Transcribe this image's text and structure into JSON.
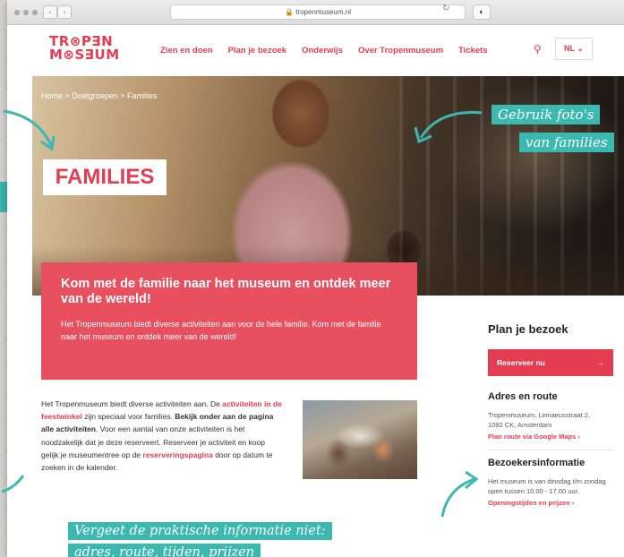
{
  "browser": {
    "url": "tropenmuseum.nl",
    "back_icon": "‹",
    "forward_icon": "›",
    "reload_icon": "↻",
    "shield_icon": "◐"
  },
  "logo": {
    "line1": "TR⊗P∃N",
    "line2": "M⊗S∃UM"
  },
  "nav": {
    "items": [
      "Zien en doen",
      "Plan je bezoek",
      "Onderwijs",
      "Over Tropenmuseum",
      "Tickets"
    ],
    "search_icon": "⚲",
    "lang": "NL ⌄"
  },
  "hero": {
    "breadcrumb": "Home > Doelgroepen > Families",
    "title": "FAMILIES"
  },
  "intro": {
    "heading": "Kom met de familie naar het museum en ontdek meer van de wereld!",
    "text": "Het Tropenmuseum biedt diverse activiteiten aan voor de hele familie. Kom met de familie naar het museum en ontdek meer van de wereld!"
  },
  "body": {
    "p1": "Het Tropenmuseum biedt diverse activiteiten aan. De ",
    "link1": "activiteiten in de feestwinkel",
    "p2": " zijn speciaal voor families. ",
    "bold1": "Bekijk onder aan de pagina alle activiteiten",
    "p3": ". Voor een aantal van onze activiteiten is het noodzakelijk dat je deze reserveert. Reserveer je activiteit en koop gelijk je museumentree op de ",
    "link2": "reserveringspagina",
    "p4": " door op datum te zoeken in de kalender."
  },
  "sidebar": {
    "plan_heading": "Plan je bezoek",
    "reserve_label": "Reserveer nu",
    "reserve_arrow": "→",
    "address_heading": "Adres en route",
    "address_line1": "Tropenmuseum, Linnaeusstraat 2,",
    "address_line2": "1092 CK, Amsterdam",
    "route_link": "Plan route via Google Maps ›",
    "info_heading": "Bezoekersinformatie",
    "info_text": "Het museum is van dinsdag t/m zondag open tussen 10.00 - 17.00 uur.",
    "hours_link": "Openingstijden en prijzen ›"
  },
  "annotations": {
    "photo_line1": "Gebruik foto's",
    "photo_line2": "van families",
    "practical_line1": "Vergeet de praktische informatie niet:",
    "practical_line2": "adres, route, tijden, prijzen"
  },
  "colors": {
    "brand_red": "#e43d52",
    "box_red": "#e9505f",
    "teal": "#3bb8b0"
  }
}
